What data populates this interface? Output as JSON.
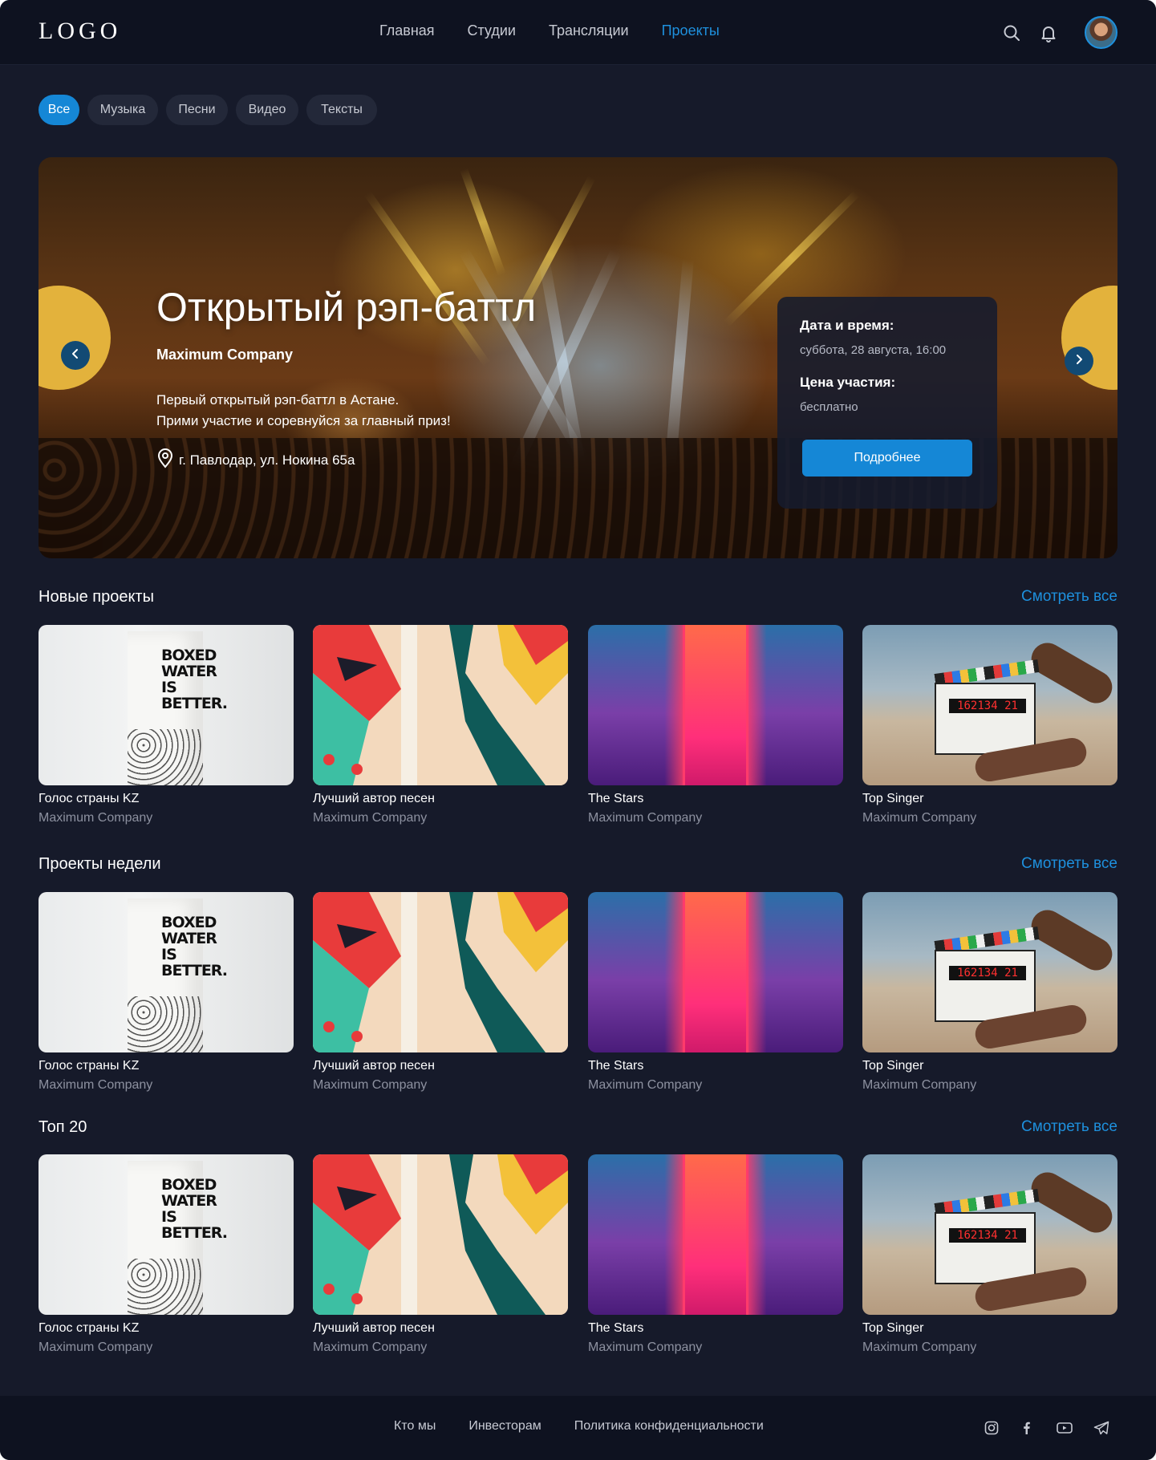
{
  "header": {
    "logo": "LOGO",
    "nav": [
      "Главная",
      "Студии",
      "Трансляции",
      "Проекты"
    ],
    "active_nav": "Проекты"
  },
  "filters": [
    "Все",
    "Музыка",
    "Песни",
    "Видео",
    "Тексты"
  ],
  "hero": {
    "title": "Открытый рэп-баттл",
    "company": "Maximum Company",
    "desc_line1": "Первый открытый рэп-баттл в Астане.",
    "desc_line2": "Прими участие и соревнуйся за главный приз!",
    "location": "г. Павлодар, ул. Нокина 65а",
    "date_label": "Дата и время:",
    "date_value": "суббота, 28 августа, 16:00",
    "price_label": "Цена участия:",
    "price_value": "бесплатно",
    "button": "Подробнее"
  },
  "sections": [
    {
      "title": "Новые проекты",
      "link": "Смотреть все",
      "cards": [
        {
          "title": "Голос страны KZ",
          "company": "Maximum Company"
        },
        {
          "title": "Лучший автор песен",
          "company": "Maximum Company"
        },
        {
          "title": "The Stars",
          "company": "Maximum Company"
        },
        {
          "title": "Top Singer",
          "company": "Maximum Company"
        }
      ]
    },
    {
      "title": "Проекты недели",
      "link": "Смотреть все",
      "cards": [
        {
          "title": "Голос страны KZ",
          "company": "Maximum Company"
        },
        {
          "title": "Лучший автор песен",
          "company": "Maximum Company"
        },
        {
          "title": "The Stars",
          "company": "Maximum Company"
        },
        {
          "title": "Top Singer",
          "company": "Maximum Company"
        }
      ]
    },
    {
      "title": "Топ 20",
      "link": "Смотреть все",
      "cards": [
        {
          "title": "Голос страны KZ",
          "company": "Maximum Company"
        },
        {
          "title": "Лучший автор песен",
          "company": "Maximum Company"
        },
        {
          "title": "The Stars",
          "company": "Maximum Company"
        },
        {
          "title": "Top Singer",
          "company": "Maximum Company"
        }
      ]
    }
  ],
  "thumb_text": {
    "carton": "BOXED WATER IS BETTER.",
    "clapper": "162134 21"
  },
  "footer": {
    "links": [
      "Кто мы",
      "Инвесторам",
      "Политика конфиденциальности"
    ],
    "social_icons": [
      "instagram-icon",
      "facebook-icon",
      "youtube-icon",
      "telegram-icon"
    ]
  },
  "colors": {
    "background": "#161a2a",
    "header": "#0e1220",
    "accent": "#1587d6",
    "link": "#1e90dd"
  }
}
